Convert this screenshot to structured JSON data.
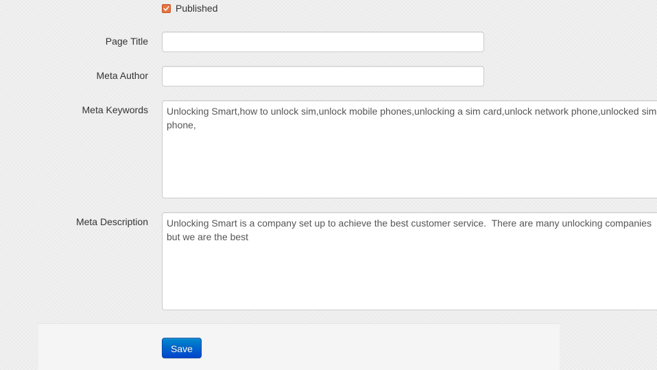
{
  "form": {
    "published": {
      "label": "Published",
      "checked": true
    },
    "page_title": {
      "label": "Page Title",
      "value": ""
    },
    "meta_author": {
      "label": "Meta Author",
      "value": ""
    },
    "meta_keywords": {
      "label": "Meta Keywords",
      "value": "Unlocking Smart,how to unlock sim,unlock mobile phones,unlocking a sim card,unlock network phone,unlocked sim phone,"
    },
    "meta_description": {
      "label": "Meta Description",
      "value": "Unlocking Smart is a company set up to achieve the best customer service.  There are many unlocking companies but we are the best"
    }
  },
  "actions": {
    "save_label": "Save"
  },
  "colors": {
    "checkbox_accent": "#e8743f",
    "primary_button": "#0055cc"
  }
}
